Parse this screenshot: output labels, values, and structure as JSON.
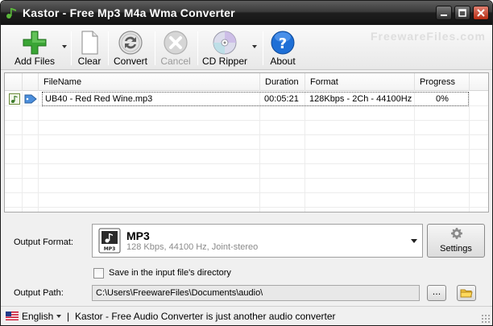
{
  "window": {
    "title": "Kastor - Free Mp3 M4a Wma Converter",
    "watermark": "FreewareFiles.com"
  },
  "toolbar": {
    "add_files": "Add Files",
    "clear": "Clear",
    "convert": "Convert",
    "cancel": "Cancel",
    "cd_ripper": "CD Ripper",
    "about": "About"
  },
  "list": {
    "columns": {
      "filename": "FileName",
      "duration": "Duration",
      "format": "Format",
      "progress": "Progress"
    },
    "rows": [
      {
        "filename": "UB40 - Red Red Wine.mp3",
        "duration": "00:05:21",
        "format": "128Kbps - 2Ch - 44100Hz",
        "progress": "0%"
      }
    ]
  },
  "output": {
    "format_label": "Output Format:",
    "format_name": "MP3",
    "format_desc": "128 Kbps, 44100 Hz, Joint-stereo",
    "format_icon_text": "MP3",
    "settings_label": "Settings",
    "save_in_input_dir_label": "Save in the input file's directory",
    "save_in_input_dir_checked": false,
    "path_label": "Output Path:",
    "path_value": "C:\\Users\\FreewareFiles\\Documents\\audio\\",
    "browse_label": "..."
  },
  "status": {
    "language": "English",
    "separator": "|",
    "message": "Kastor - Free Audio Converter is just another audio converter"
  },
  "colors": {
    "accent_green": "#3aa535",
    "about_blue": "#1e6fd6",
    "titlebar_dark": "#1e1e1e"
  },
  "icons": {
    "add_files": "plus-icon",
    "clear": "document-icon",
    "convert": "convert-arrows-icon",
    "cancel": "cancel-x-icon",
    "cd_ripper": "cd-icon",
    "about": "help-question-icon",
    "settings": "gear-icon",
    "folder": "folder-icon"
  }
}
